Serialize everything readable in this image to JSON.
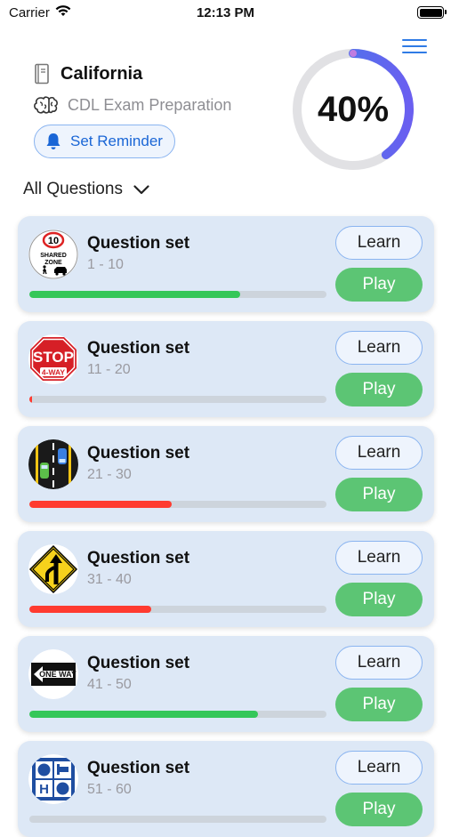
{
  "status_bar": {
    "carrier": "Carrier",
    "time": "12:13 PM"
  },
  "header": {
    "state": "California",
    "exam": "CDL Exam Preparation",
    "reminder_label": "Set Reminder",
    "progress_text": "40%",
    "progress_value": 0.4
  },
  "filter": {
    "label": "All Questions"
  },
  "colors": {
    "accent": "#2f7be5",
    "green": "#34c759",
    "red": "#ff3b30",
    "play": "#5cc574",
    "card": "#dde8f6"
  },
  "question_sets": [
    {
      "title": "Question set",
      "range": "1 - 10",
      "icon": "shared-zone-sign-icon",
      "progress": 0.71,
      "color": "#34c759",
      "learn": "Learn",
      "play": "Play"
    },
    {
      "title": "Question set",
      "range": "11 - 20",
      "icon": "stop-sign-icon",
      "progress": 0.01,
      "color": "#ff3b30",
      "learn": "Learn",
      "play": "Play"
    },
    {
      "title": "Question set",
      "range": "21 - 30",
      "icon": "two-lane-road-icon",
      "progress": 0.48,
      "color": "#ff3b30",
      "learn": "Learn",
      "play": "Play"
    },
    {
      "title": "Question set",
      "range": "31 - 40",
      "icon": "merge-sign-icon",
      "progress": 0.41,
      "color": "#ff3b30",
      "learn": "Learn",
      "play": "Play"
    },
    {
      "title": "Question set",
      "range": "41 - 50",
      "icon": "one-way-sign-icon",
      "progress": 0.77,
      "color": "#34c759",
      "learn": "Learn",
      "play": "Play"
    },
    {
      "title": "Question set",
      "range": "51 - 60",
      "icon": "hospital-services-sign-icon",
      "progress": 0.0,
      "color": "#34c759",
      "learn": "Learn",
      "play": "Play"
    }
  ],
  "icon_text": {
    "shared_zone_speed": "10",
    "shared_zone_word1": "SHARED",
    "shared_zone_word2": "ZONE",
    "stop_main": "STOP",
    "stop_sub": "4-WAY",
    "one_way": "ONE WAY",
    "hospital_letter": "H"
  }
}
